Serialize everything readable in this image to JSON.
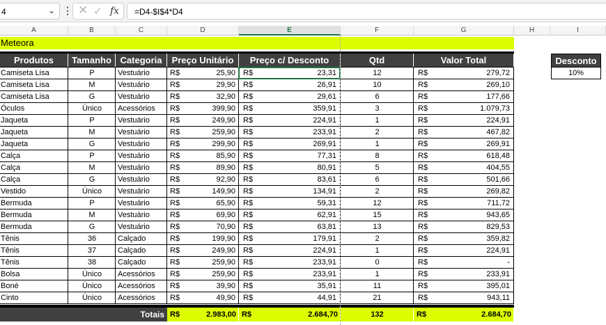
{
  "formula_bar": {
    "name_box": "4",
    "formula": "=D4-$I$4*D4"
  },
  "columns": [
    "A",
    "B",
    "C",
    "D",
    "E",
    "F",
    "G",
    "H",
    "I"
  ],
  "sheet": {
    "title": "Meteora",
    "headers": [
      "Produtos",
      "Tamanho",
      "Categoria",
      "Preço Unitário",
      "Preço c/ Desconto",
      "Qtd",
      "Valor Total"
    ],
    "currency": "R$",
    "rows": [
      [
        "Camiseta Lisa",
        "P",
        "Vestuário",
        "25,90",
        "23,31",
        "12",
        "279,72"
      ],
      [
        "Camiseta Lisa",
        "M",
        "Vestuário",
        "29,90",
        "26,91",
        "10",
        "269,10"
      ],
      [
        "Camiseta Lisa",
        "G",
        "Vestuário",
        "32,90",
        "29,61",
        "6",
        "177,66"
      ],
      [
        "Óculos",
        "Único",
        "Acessórios",
        "399,90",
        "359,91",
        "3",
        "1.079,73"
      ],
      [
        "Jaqueta",
        "P",
        "Vestuário",
        "249,90",
        "224,91",
        "1",
        "224,91"
      ],
      [
        "Jaqueta",
        "M",
        "Vestuário",
        "259,90",
        "233,91",
        "2",
        "467,82"
      ],
      [
        "Jaqueta",
        "G",
        "Vestuário",
        "299,90",
        "269,91",
        "1",
        "269,91"
      ],
      [
        "Calça",
        "P",
        "Vestuário",
        "85,90",
        "77,31",
        "8",
        "618,48"
      ],
      [
        "Calça",
        "M",
        "Vestuário",
        "89,90",
        "80,91",
        "5",
        "404,55"
      ],
      [
        "Calça",
        "G",
        "Vestuário",
        "92,90",
        "83,61",
        "6",
        "501,66"
      ],
      [
        "Vestido",
        "Único",
        "Vestuário",
        "149,90",
        "134,91",
        "2",
        "269,82"
      ],
      [
        "Bermuda",
        "P",
        "Vestuário",
        "65,90",
        "59,31",
        "12",
        "711,72"
      ],
      [
        "Bermuda",
        "M",
        "Vestuário",
        "69,90",
        "62,91",
        "15",
        "943,65"
      ],
      [
        "Bermuda",
        "G",
        "Vestuário",
        "70,90",
        "63,81",
        "13",
        "829,53"
      ],
      [
        "Tênis",
        "36",
        "Calçado",
        "199,90",
        "179,91",
        "2",
        "359,82"
      ],
      [
        "Tênis",
        "37",
        "Calçado",
        "249,90",
        "224,91",
        "1",
        "224,91"
      ],
      [
        "Tênis",
        "38",
        "Calçado",
        "259,90",
        "233,91",
        "0",
        "-"
      ],
      [
        "Bolsa",
        "Único",
        "Acessórios",
        "259,90",
        "233,91",
        "1",
        "233,91"
      ],
      [
        "Boné",
        "Único",
        "Acessórios",
        "39,90",
        "35,91",
        "11",
        "395,01"
      ],
      [
        "Cinto",
        "Único",
        "Acessórios",
        "49,90",
        "44,91",
        "21",
        "943,11"
      ]
    ],
    "totals": {
      "label": "Totais",
      "preco_unitario": "2.983,00",
      "preco_desconto": "2.684,70",
      "qtd": "132",
      "valor_total": "2.684,70"
    },
    "discount": {
      "label": "Desconto",
      "value": "10%"
    }
  }
}
